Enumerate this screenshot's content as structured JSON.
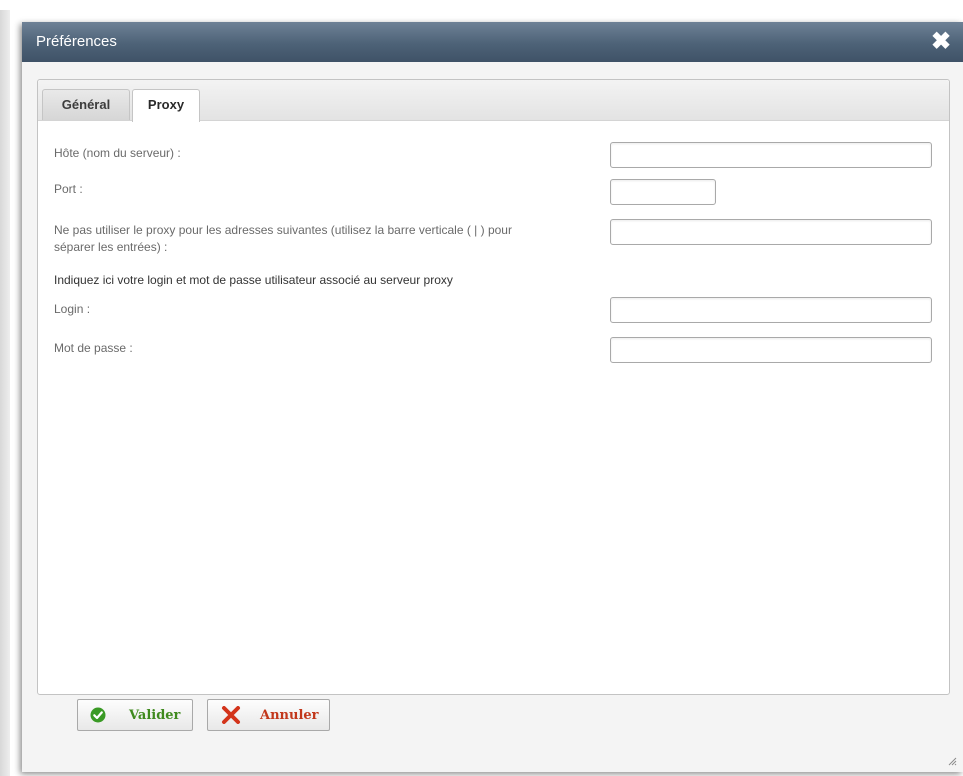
{
  "window": {
    "title": "Préférences",
    "close_glyph": "✖",
    "icon": "close-icon"
  },
  "tabs": [
    {
      "label": "Général",
      "active": false
    },
    {
      "label": "Proxy",
      "active": true
    }
  ],
  "form": {
    "host_label": "Hôte (nom du serveur) :",
    "host_value": "",
    "port_label": "Port :",
    "port_value": "",
    "noproxy_label_line1": "Ne pas utiliser le proxy pour les adresses suivantes (utilisez la barre verticale ( | ) pour",
    "noproxy_label_line2": "séparer les entrées) :",
    "noproxy_value": "",
    "auth_note": "Indiquez ici votre login et mot de passe utilisateur associé au serveur proxy",
    "login_label": "Login :",
    "login_value": "",
    "password_label": "Mot de passe :",
    "password_value": ""
  },
  "buttons": {
    "ok_label": "Valider",
    "ok_icon": "check-circle-icon",
    "cancel_label": "Annuler",
    "cancel_icon": "red-x-icon"
  },
  "colors": {
    "titlebar": "#4d6277",
    "ok_text": "#3f8a1e",
    "cancel_text": "#c2371b"
  }
}
